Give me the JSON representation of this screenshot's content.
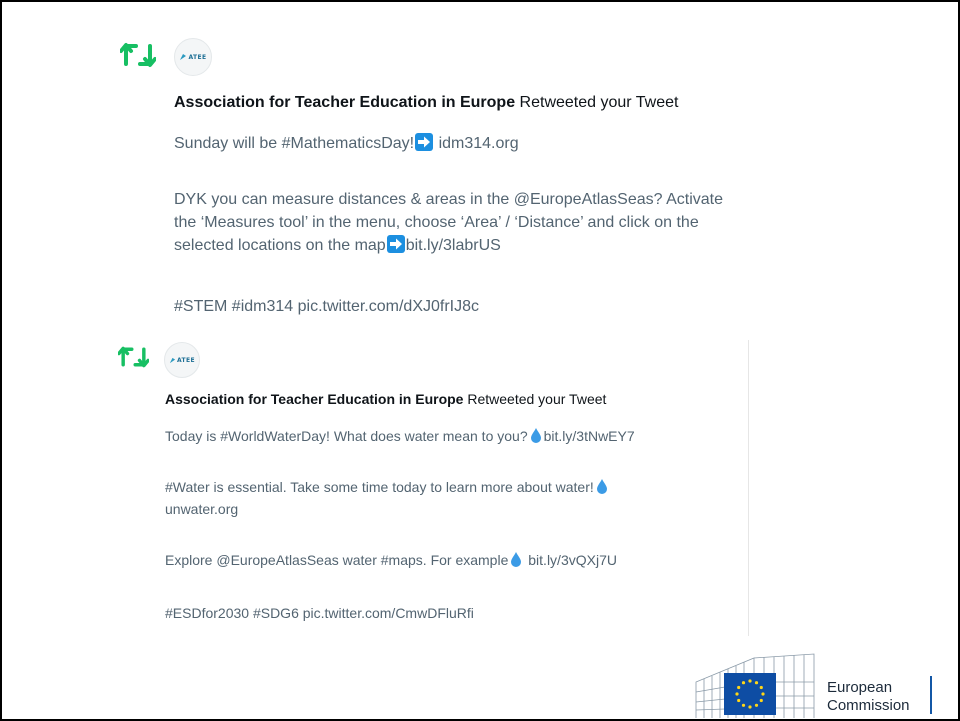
{
  "notifications": [
    {
      "org_name": "Association for Teacher Education in Europe",
      "action_text": " Retweeted your Tweet",
      "avatar_label": "ATEE",
      "paragraphs": [
        {
          "lines": [
            "Sunday will be #MathematicsDay!",
            "idm314.org"
          ],
          "emoji": "right-arrow"
        },
        {
          "lines": [
            "DYK you can measure distances & areas in the @EuropeAtlasSeas? Activate",
            "the ‘Measures tool’ in the menu, choose ‘Area’ / ‘Distance’ and click on the",
            "selected locations on the map",
            "bit.ly/3labrUS"
          ]
        },
        {
          "lines": [
            "#STEM #idm314 pic.twitter.com/dXJ0frIJ8c"
          ]
        }
      ]
    },
    {
      "org_name": "Association for Teacher Education in Europe",
      "action_text": " Retweeted your Tweet",
      "avatar_label": "ATEE",
      "paragraphs": [
        {
          "lines": [
            "Today is #WorldWaterDay! What does water mean to you?",
            "bit.ly/3tNwEY7"
          ],
          "emoji": "droplet"
        },
        {
          "lines": [
            "#Water is essential. Take some time today to learn more about water!",
            "unwater.org"
          ],
          "emoji": "droplet"
        },
        {
          "lines": [
            "Explore @EuropeAtlasSeas water #maps. For example",
            "bit.ly/3vQXj7U"
          ],
          "emoji": "droplet"
        },
        {
          "lines": [
            "#ESDfor2030 #SDG6 pic.twitter.com/CmwDFluRfi"
          ]
        }
      ]
    }
  ],
  "footer": {
    "logo_line1": "European",
    "logo_line2": "Commission"
  },
  "colors": {
    "retweet_green": "#17bf63",
    "body_text": "#536471",
    "emoji_blue": "#1c8fe0",
    "droplet_blue": "#3b9be6",
    "eu_blue": "#0e4da4",
    "eu_star": "#ffd617"
  },
  "icons": [
    "retweet-icon",
    "atee-logo-icon",
    "right-arrow-icon",
    "droplet-icon",
    "european-commission-logo"
  ]
}
